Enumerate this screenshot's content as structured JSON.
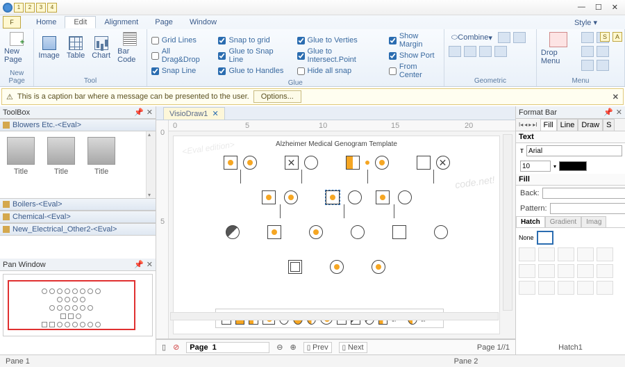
{
  "qat": [
    "1",
    "2",
    "3",
    "4"
  ],
  "file_letter": "F",
  "tabs": [
    "Home",
    "Edit",
    "Alignment",
    "Page",
    "Window"
  ],
  "active_tab": "Edit",
  "style_label": "Style",
  "ribbon": {
    "newpage": "New Page",
    "image": "Image",
    "table": "Table",
    "chart": "Chart",
    "barcode": "Bar Code",
    "group_tool": "Tool",
    "group_glue": "Glue",
    "group_geom": "Geometric",
    "group_menu": "Menu",
    "drop": "Drop Menu",
    "col1": [
      "Grid Lines",
      "All Drag&Drop",
      "Snap Line"
    ],
    "col1_checked": [
      false,
      false,
      true
    ],
    "col2": [
      "Snap to grid",
      "Glue to Snap Line",
      "Glue to Handles"
    ],
    "col2_checked": [
      true,
      true,
      true
    ],
    "col3": [
      "Glue to Verties",
      "Glue to Intersect.Point",
      "Hide all snap"
    ],
    "col3_checked": [
      true,
      true,
      false
    ],
    "col4": [
      "Show Margin",
      "Show Port",
      "From Center"
    ],
    "col4_checked": [
      true,
      true,
      false
    ],
    "combine": "Combine"
  },
  "caption": {
    "msg": "This is a caption bar where a message can be presented to the user.",
    "options": "Options..."
  },
  "toolbox": {
    "title": "ToolBox",
    "sections": [
      "Blowers Etc.-<Eval>",
      "Boilers-<Eval>",
      "Chemical-<Eval>",
      "New_Electrical_Other2-<Eval>"
    ],
    "item_label": "Title"
  },
  "panwin": {
    "title": "Pan Window"
  },
  "doc": {
    "tab": "VisioDraw1",
    "page_title": "Alzheimer Medical Genogram Template",
    "watermark": "code.net!",
    "watermark2": "<Eval edition>"
  },
  "rulers": {
    "h": [
      "0",
      "5",
      "10",
      "15",
      "20"
    ],
    "v": [
      "0",
      "5"
    ]
  },
  "nav": {
    "page_field": "Page  1",
    "prev": "Prev",
    "next": "Next",
    "pager": "Page 1//1"
  },
  "format": {
    "title": "Format Bar",
    "tabs": [
      "Fill",
      "Line",
      "Draw",
      "S"
    ],
    "text_h": "Text",
    "font": "Arial",
    "size": "10",
    "fill_h": "Fill",
    "back": "Back:",
    "pattern": "Pattern:",
    "hatch_tabs": [
      "Hatch",
      "Gradient",
      "Imag"
    ],
    "none": "None",
    "hatch_name": "Hatch1"
  },
  "status": {
    "p1": "Pane 1",
    "p2": "Pane 2"
  },
  "right_badges": [
    "S",
    "A"
  ],
  "palette_labels": [
    "Male in",
    "Female in"
  ]
}
